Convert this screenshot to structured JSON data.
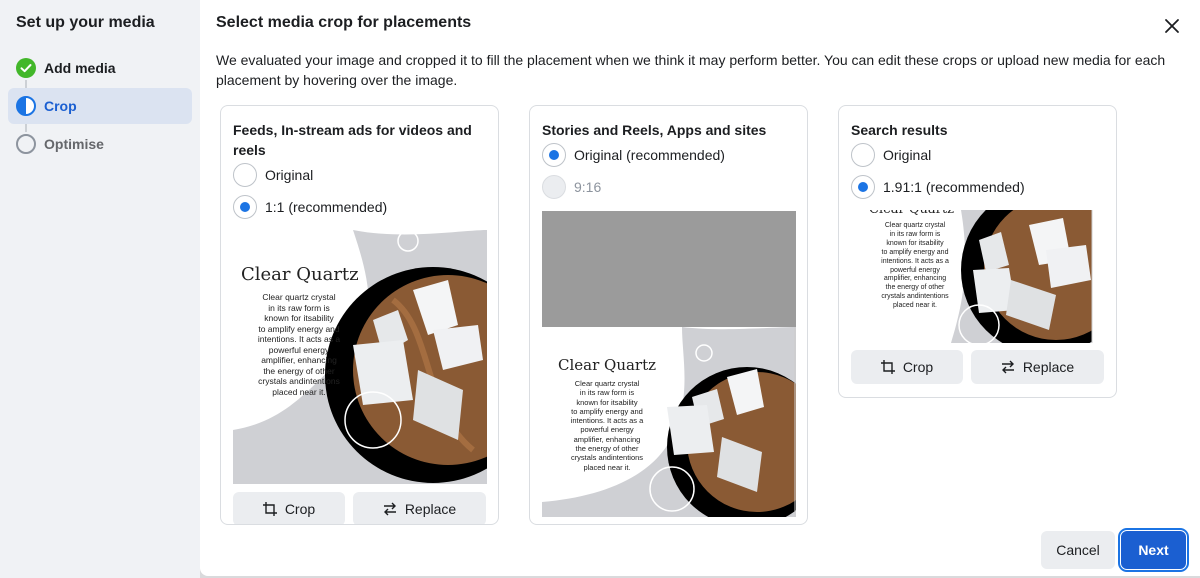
{
  "sidebar": {
    "title": "Set up your media",
    "steps": [
      {
        "label": "Add media",
        "state": "complete",
        "icon": "check-circle-icon"
      },
      {
        "label": "Crop",
        "state": "active",
        "icon": "half-circle-icon"
      },
      {
        "label": "Optimise",
        "state": "pending",
        "icon": "empty-circle-icon"
      }
    ]
  },
  "modal": {
    "title": "Select media crop for placements",
    "description": "We evaluated your image and cropped it to fill the placement when we think it may perform better. You can edit these crops or upload new media for each placement by hovering over the image."
  },
  "cards": [
    {
      "title": "Feeds, In-stream ads for videos and reels",
      "options": [
        {
          "label": "Original",
          "checked": false,
          "disabled": false
        },
        {
          "label": "1:1 (recommended)",
          "checked": true,
          "disabled": false
        }
      ],
      "crop_label": "Crop",
      "replace_label": "Replace"
    },
    {
      "title": "Stories and Reels, Apps and sites",
      "options": [
        {
          "label": "Original (recommended)",
          "checked": true,
          "disabled": false
        },
        {
          "label": "9:16",
          "checked": false,
          "disabled": true
        }
      ],
      "crop_label": "Crop",
      "replace_label": "Replace"
    },
    {
      "title": "Search results",
      "options": [
        {
          "label": "Original",
          "checked": false,
          "disabled": false
        },
        {
          "label": "1.91:1 (recommended)",
          "checked": true,
          "disabled": false
        }
      ],
      "crop_label": "Crop",
      "replace_label": "Replace"
    }
  ],
  "artwork": {
    "heading": "Clear Quartz",
    "body_lines": [
      "Clear quartz crystal",
      "in its raw form is",
      "known for itsability",
      "to amplify energy and",
      "intentions. It acts as a",
      "powerful energy",
      "amplifier, enhancing",
      "the energy of other",
      "crystals andintentions",
      "placed  near it."
    ]
  },
  "footer": {
    "cancel_label": "Cancel",
    "next_label": "Next"
  },
  "colors": {
    "accent": "#1b5fd1",
    "radio_checked": "#1b74e4",
    "success": "#42b72a"
  }
}
